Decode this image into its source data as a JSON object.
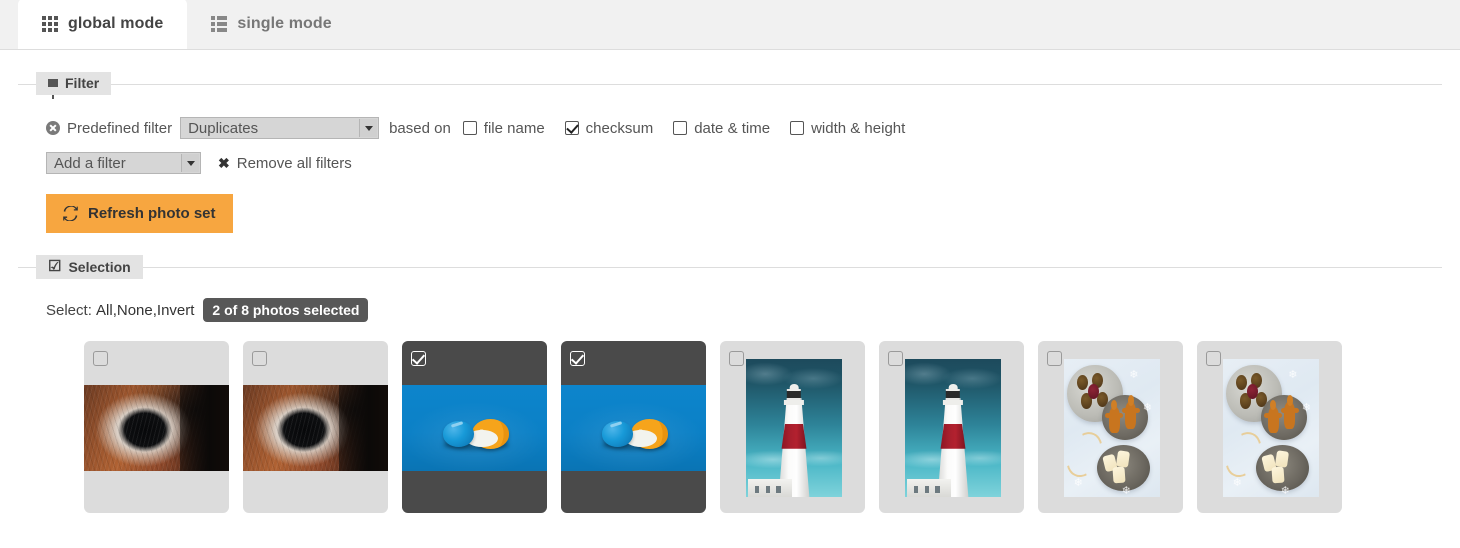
{
  "tabs": [
    {
      "id": "global",
      "label": "global mode",
      "icon": "grid-icon",
      "active": true
    },
    {
      "id": "single",
      "label": "single mode",
      "icon": "list-icon",
      "active": false
    }
  ],
  "filter": {
    "legend": "Filter",
    "legend_icon": "funnel-icon",
    "remove_icon": "remove-circle-icon",
    "predefined_label": "Predefined filter",
    "predefined_value": "Duplicates",
    "based_on_label": "based on",
    "criteria": [
      {
        "label": "file name",
        "checked": false
      },
      {
        "label": "checksum",
        "checked": true
      },
      {
        "label": "date & time",
        "checked": false
      },
      {
        "label": "width & height",
        "checked": false
      }
    ],
    "add_filter_value": "Add a filter",
    "remove_all_label": "Remove all filters",
    "remove_all_icon": "x-icon",
    "refresh_label": "Refresh photo set",
    "refresh_icon": "sync-icon",
    "refresh_color": "#f7a640"
  },
  "selection": {
    "legend": "Selection",
    "legend_icon": "checkbox-icon",
    "select_label": "Select:",
    "actions": [
      "All",
      "None",
      "Invert"
    ],
    "separator": ", ",
    "badge": "2 of 8 photos selected",
    "badge_color": "#585858"
  },
  "photos": [
    {
      "art": "horse",
      "orientation": "landscape",
      "selected": false
    },
    {
      "art": "horse",
      "orientation": "landscape",
      "selected": false
    },
    {
      "art": "orange",
      "orientation": "landscape",
      "selected": true
    },
    {
      "art": "orange",
      "orientation": "landscape",
      "selected": true
    },
    {
      "art": "light",
      "orientation": "portrait",
      "selected": false
    },
    {
      "art": "light",
      "orientation": "portrait",
      "selected": false
    },
    {
      "art": "cookie",
      "orientation": "portrait",
      "selected": false
    },
    {
      "art": "cookie",
      "orientation": "portrait",
      "selected": false
    }
  ]
}
